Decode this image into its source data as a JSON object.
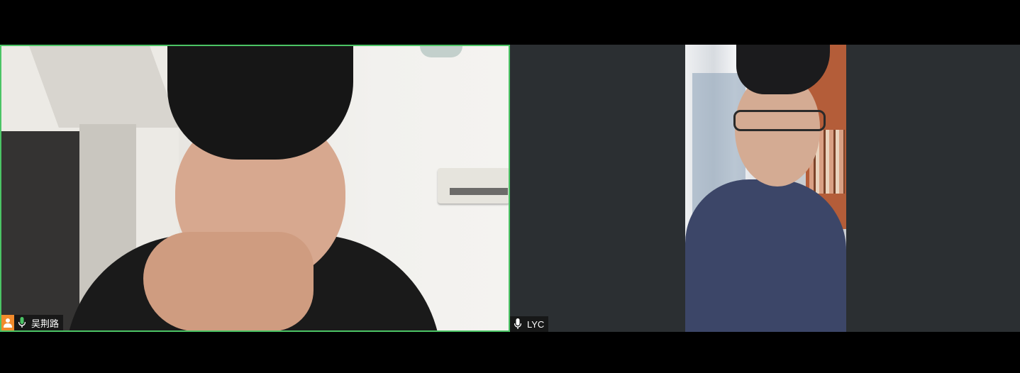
{
  "participants": [
    {
      "name": "吴荆路",
      "host": true,
      "mic": "mic-on-icon",
      "active_speaker": true,
      "border_color": "#4bc465"
    },
    {
      "name": "LYC",
      "host": false,
      "mic": "mic-on-icon",
      "active_speaker": false
    }
  ],
  "colors": {
    "background": "#000000",
    "tile_background": "#2b2f32",
    "active_border": "#4bc465",
    "host_badge": "#f28b2c"
  }
}
